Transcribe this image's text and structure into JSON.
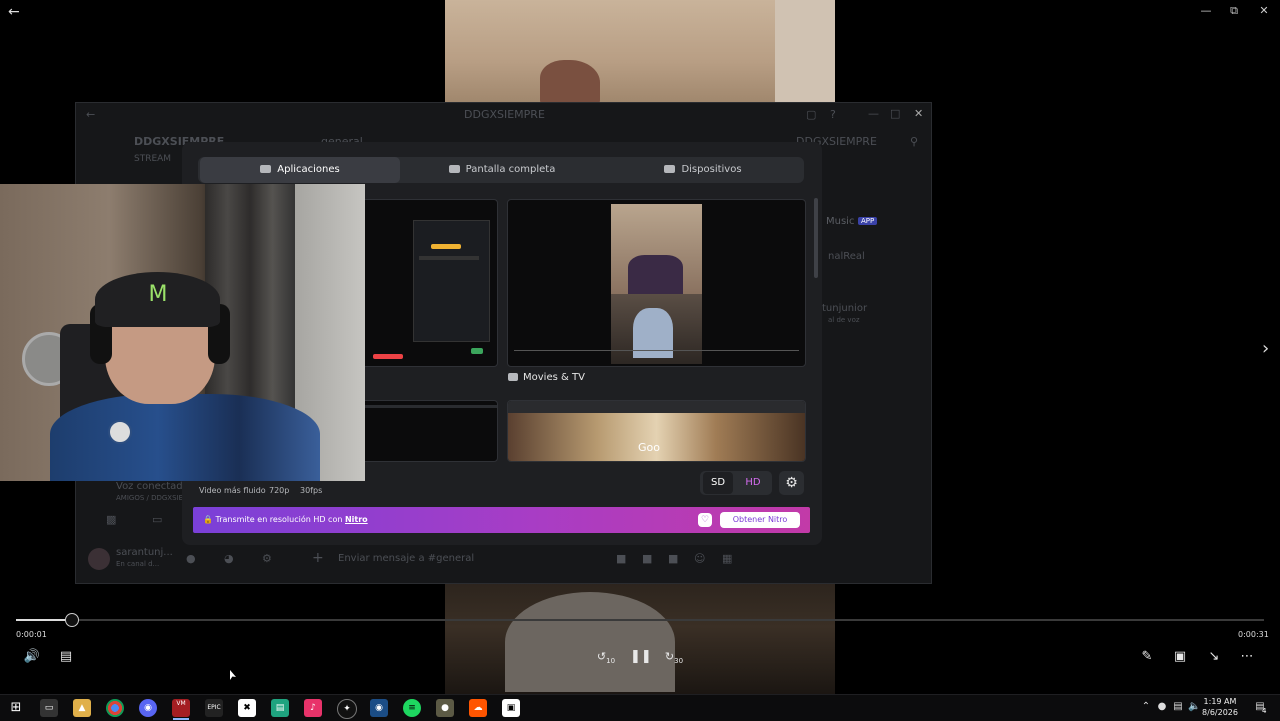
{
  "player": {
    "current_time": "0:00:01",
    "total_time": "0:00:31",
    "progress": 0.03,
    "skip_back_label": "10",
    "skip_fwd_label": "30"
  },
  "discord": {
    "window_title": "DDGXSIEMPRE",
    "server_name": "DDGXSIEMPRE",
    "stream_label": "STREAM",
    "channel_hint": "general",
    "member_header": "DDGXSIEMPRE",
    "bottom_status": "Voz conectada",
    "bottom_status_sub": "AMIGOS / DDGXSIEMPRE",
    "user_name": "sarantunj...",
    "user_sub": "En canal d...",
    "music_label": "Music",
    "app_badge": "APP",
    "member_1": "nalReal",
    "member_2": "tunjunior",
    "member_sub": "al de voz",
    "message_placeholder": "Enviar mensaje a #general"
  },
  "share_dialog": {
    "tabs": [
      {
        "label": "Aplicaciones",
        "active": true
      },
      {
        "label": "Pantalla completa",
        "active": false
      },
      {
        "label": "Dispositivos",
        "active": false
      }
    ],
    "thumbnails": [
      {
        "label": ""
      },
      {
        "label": "Movies & TV"
      },
      {
        "label": ""
      },
      {
        "label": ""
      }
    ],
    "quality_text": "Video más fluido",
    "resolution": "720p",
    "fps": "30fps",
    "sd_label": "SD",
    "hd_label": "HD",
    "banner_text": "Transmite en resolución HD con",
    "banner_nitro": "Nitro",
    "nitro_button": "Obtener Nitro"
  },
  "taskbar": {
    "apps": [
      "start",
      "task-view",
      "file-explorer",
      "chrome",
      "discord-vpn",
      "voicemeeter",
      "epic-games",
      "capcut",
      "terminal",
      "tiktok",
      "chatgpt",
      "steam",
      "spotify",
      "gimp",
      "soundcloud",
      "clapper"
    ],
    "time": "1:19 AM",
    "date": "8/6/2026",
    "notifications": "4"
  },
  "colors": {
    "accent": "#5865f2",
    "nitro_start": "#7a40d8",
    "nitro_end": "#c23aa8",
    "hd_text": "#d56cf0"
  }
}
